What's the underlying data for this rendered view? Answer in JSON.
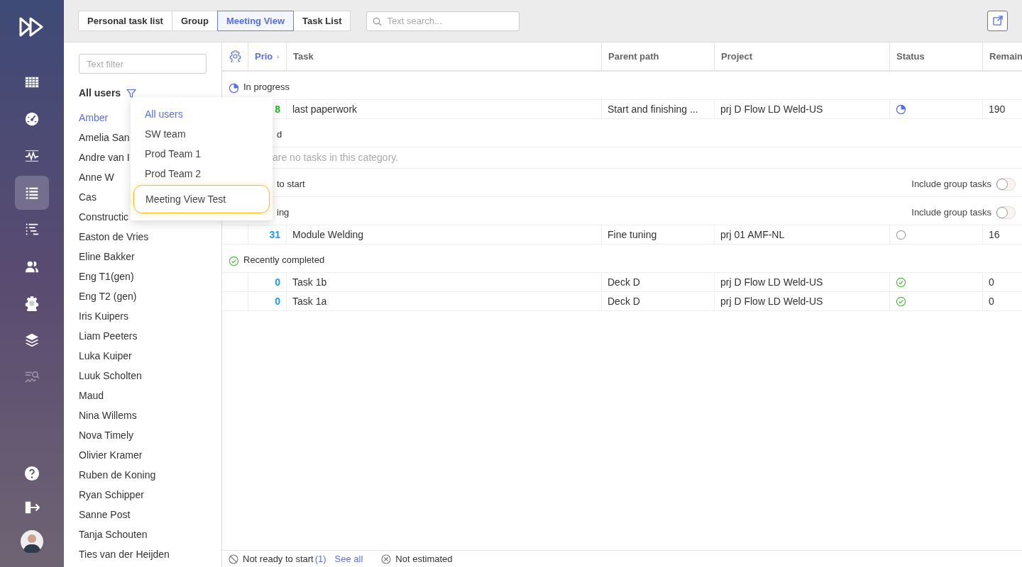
{
  "nav": {
    "items": [
      {
        "kind": "grid",
        "selected": false
      },
      {
        "kind": "gauge",
        "selected": false
      },
      {
        "kind": "pulse",
        "selected": false
      },
      {
        "kind": "list",
        "selected": true
      },
      {
        "kind": "gantt",
        "selected": false
      },
      {
        "kind": "people",
        "selected": false
      },
      {
        "kind": "gear",
        "selected": false
      },
      {
        "kind": "layers",
        "selected": false
      },
      {
        "kind": "analysis",
        "selected": false,
        "disabled": true
      }
    ],
    "bottom": [
      {
        "kind": "help"
      },
      {
        "kind": "logout"
      },
      {
        "kind": "avatar"
      }
    ]
  },
  "tabs": [
    {
      "label": "Personal task list",
      "selected": false
    },
    {
      "label": "Group",
      "selected": false
    },
    {
      "label": "Meeting View",
      "selected": true
    },
    {
      "label": "Task List",
      "selected": false
    }
  ],
  "search": {
    "placeholder": "Text search..."
  },
  "user_panel": {
    "filter_placeholder": "Text filter",
    "heading": "All users",
    "users": [
      {
        "name": "Amber",
        "selected": true
      },
      {
        "name": "Amelia San",
        "selected": false
      },
      {
        "name": "Andre van I",
        "selected": false
      },
      {
        "name": "Anne W",
        "selected": false
      },
      {
        "name": "Cas",
        "selected": false
      },
      {
        "name": "Constructic",
        "selected": false
      },
      {
        "name": "Easton de Vries",
        "selected": false
      },
      {
        "name": "Eline Bakker",
        "selected": false
      },
      {
        "name": "Eng T1(gen)",
        "selected": false
      },
      {
        "name": "Eng T2 (gen)",
        "selected": false
      },
      {
        "name": "Iris Kuipers",
        "selected": false
      },
      {
        "name": "Liam Peeters",
        "selected": false
      },
      {
        "name": "Luka Kuiper",
        "selected": false
      },
      {
        "name": "Luuk Scholten",
        "selected": false
      },
      {
        "name": "Maud",
        "selected": false
      },
      {
        "name": "Nina Willems",
        "selected": false
      },
      {
        "name": "Nova Timely",
        "selected": false
      },
      {
        "name": "Olivier Kramer",
        "selected": false
      },
      {
        "name": "Ruben de Koning",
        "selected": false
      },
      {
        "name": "Ryan Schipper",
        "selected": false
      },
      {
        "name": "Sanne Post",
        "selected": false
      },
      {
        "name": "Tanja Schouten",
        "selected": false
      },
      {
        "name": "Ties van der Heijden",
        "selected": false
      }
    ]
  },
  "dropdown": {
    "items": [
      {
        "label": "All users",
        "selected": true,
        "highlighted": false
      },
      {
        "label": "SW team",
        "selected": false,
        "highlighted": false
      },
      {
        "label": "Prod Team 1",
        "selected": false,
        "highlighted": false
      },
      {
        "label": "Prod Team 2",
        "selected": false,
        "highlighted": false
      },
      {
        "label": "Meeting View Test",
        "selected": false,
        "highlighted": true
      }
    ]
  },
  "table": {
    "columns": [
      {
        "label": "Prio",
        "sorted": true
      },
      {
        "label": "Task",
        "sorted": false
      },
      {
        "label": "Parent path",
        "sorted": false
      },
      {
        "label": "Project",
        "sorted": false
      },
      {
        "label": "Status",
        "sorted": false
      },
      {
        "label": "Remain",
        "sorted": false
      }
    ],
    "sections": [
      {
        "title": "In progress",
        "kind": "in_progress",
        "rows": [
          {
            "prio": "8",
            "color": "#22b822",
            "task": "last paperwork",
            "parent": "Start and finishing ...",
            "project": "prj D Flow LD Weld-US",
            "kind": "in_progress",
            "remain": "190"
          }
        ]
      },
      {
        "title": "d",
        "empty_text": "are no tasks in this category."
      },
      {
        "title": "to start",
        "toggle": {
          "label": "Include group tasks",
          "on": false
        }
      },
      {
        "title": "ing",
        "toggle": {
          "label": "Include group tasks",
          "on": false
        },
        "rows": [
          {
            "prio": "31",
            "color": "#1a98f0",
            "task": "Module Welding",
            "parent": "Fine tuning",
            "project": "prj 01 AMF-NL",
            "kind": "not_started",
            "remain": "16"
          }
        ]
      },
      {
        "title": "Recently completed",
        "kind": "done",
        "rows": [
          {
            "prio": "0",
            "color": "#1a98f0",
            "task": "Task 1b",
            "parent": "Deck D",
            "project": "prj D Flow LD Weld-US",
            "kind": "done",
            "remain": "0"
          },
          {
            "prio": "0",
            "color": "#1a98f0",
            "task": "Task 1a",
            "parent": "Deck D",
            "project": "prj D Flow LD Weld-US",
            "kind": "done",
            "remain": "0"
          }
        ]
      }
    ]
  },
  "footer": {
    "not_ready": "Not ready to start",
    "count": "(1)",
    "link": "See all",
    "not_estimated": "Not estimated"
  }
}
